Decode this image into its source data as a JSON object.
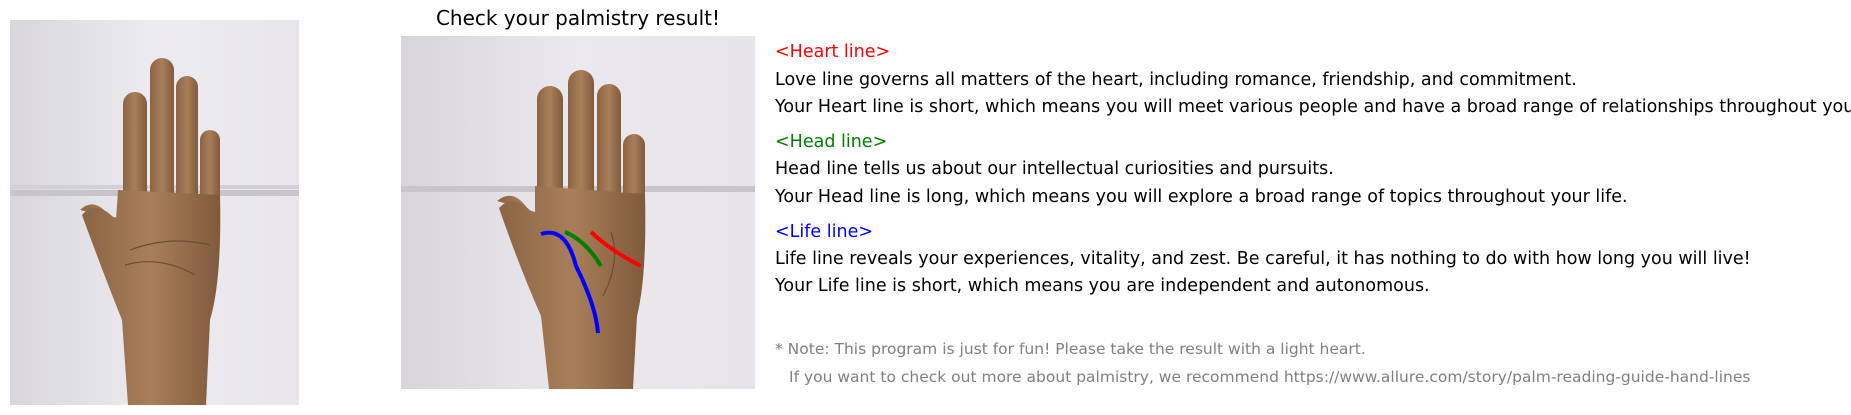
{
  "title": "Check your palmistry result!",
  "heart": {
    "header": "<Heart line>",
    "line1": "Love line governs all matters of the heart, including romance, friendship, and commitment.",
    "line2": "Your Heart line is short, which means you will meet various people and have a broad range of relationships throughout your life.",
    "color": "#ff0000"
  },
  "head": {
    "header": "<Head line>",
    "line1": "Head line tells us about our intellectual curiosities and pursuits.",
    "line2": "Your Head line is long, which means you will explore a broad range of topics throughout your life.",
    "color": "#008000"
  },
  "life": {
    "header": "<Life line>",
    "line1": "Life line reveals your experiences, vitality, and zest. Be careful, it has nothing to do with how long you will live!",
    "line2": "Your Life line is short, which means you are independent and autonomous.",
    "color": "#0000ff"
  },
  "note": {
    "line1": "* Note: This program is just for fun! Please take the result with a light heart.",
    "line2": "If you want to check out more about palmistry, we recommend https://www.allure.com/story/palm-reading-guide-hand-lines",
    "color": "#808080"
  }
}
